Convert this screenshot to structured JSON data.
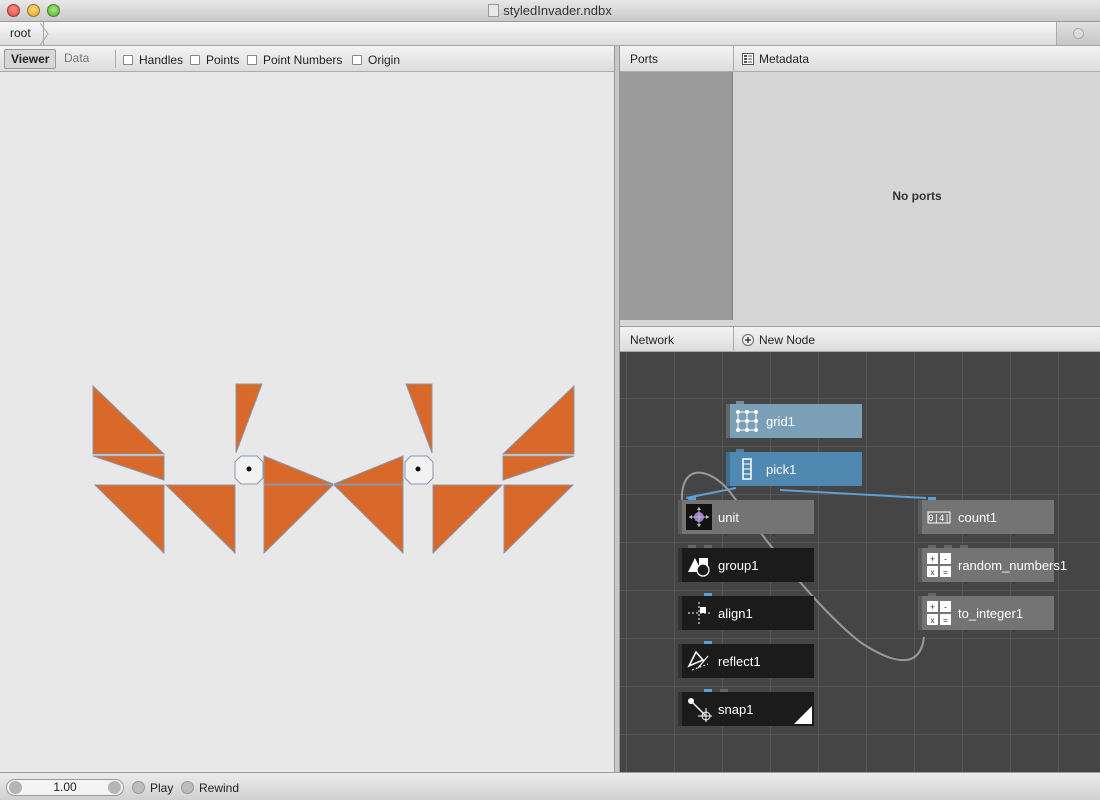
{
  "window": {
    "title": "styledInvader.ndbx"
  },
  "breadcrumb": {
    "items": [
      "root"
    ]
  },
  "viewer": {
    "tabs": [
      {
        "label": "Viewer"
      },
      {
        "label": "Data"
      }
    ],
    "options": [
      {
        "label": "Handles",
        "checked": false
      },
      {
        "label": "Points",
        "checked": false
      },
      {
        "label": "Point Numbers",
        "checked": false
      },
      {
        "label": "Origin",
        "checked": false
      }
    ],
    "shape_color": "#d9692a"
  },
  "ports": {
    "tabs": [
      {
        "label": "Ports"
      },
      {
        "label": "Metadata"
      }
    ],
    "empty_text": "No ports"
  },
  "network": {
    "title": "Network",
    "new_node_label": "New Node",
    "nodes": [
      {
        "name": "grid1",
        "icon": "grid-icon"
      },
      {
        "name": "pick1",
        "icon": "pick-icon"
      },
      {
        "name": "unit",
        "icon": "unit-icon"
      },
      {
        "name": "group1",
        "icon": "group-icon"
      },
      {
        "name": "align1",
        "icon": "align-icon"
      },
      {
        "name": "reflect1",
        "icon": "reflect-icon"
      },
      {
        "name": "snap1",
        "icon": "snap-icon"
      },
      {
        "name": "count1",
        "icon": "count-icon"
      },
      {
        "name": "random_numbers1",
        "icon": "math-icon"
      },
      {
        "name": "to_integer1",
        "icon": "math-icon"
      }
    ]
  },
  "playback": {
    "frame": "1.00",
    "play_label": "Play",
    "rewind_label": "Rewind"
  }
}
